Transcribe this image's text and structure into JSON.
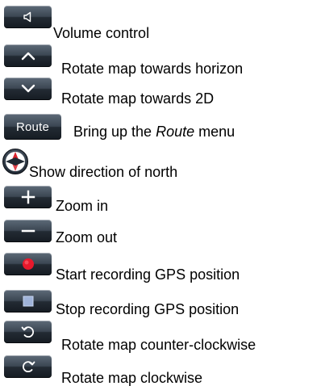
{
  "items": [
    {
      "icon": "volume-icon",
      "label": "Volume control"
    },
    {
      "icon": "chevron-up-icon",
      "label": "Rotate map towards horizon"
    },
    {
      "icon": "chevron-down-icon",
      "label": "Rotate map towards 2D"
    },
    {
      "icon": "route-button",
      "button_text": "Route",
      "label_before": "Bring up the ",
      "label_emph": "Route",
      "label_after": " menu"
    },
    {
      "icon": "compass-icon",
      "label": "Show direction of north"
    },
    {
      "icon": "plus-icon",
      "label": "Zoom in"
    },
    {
      "icon": "minus-icon",
      "label": "Zoom out"
    },
    {
      "icon": "record-icon",
      "label": "Start recording GPS position"
    },
    {
      "icon": "stop-icon",
      "label": "Stop recording GPS position"
    },
    {
      "icon": "rotate-ccw-icon",
      "label": "Rotate map counter-clockwise"
    },
    {
      "icon": "rotate-cw-icon",
      "label": "Rotate map clockwise"
    }
  ],
  "colors": {
    "button_dark": "#1b222a",
    "button_light": "#5d6a78",
    "record_red": "#e8192c",
    "compass_red": "#d9232e",
    "stop_blue": "#9fb3d9"
  }
}
